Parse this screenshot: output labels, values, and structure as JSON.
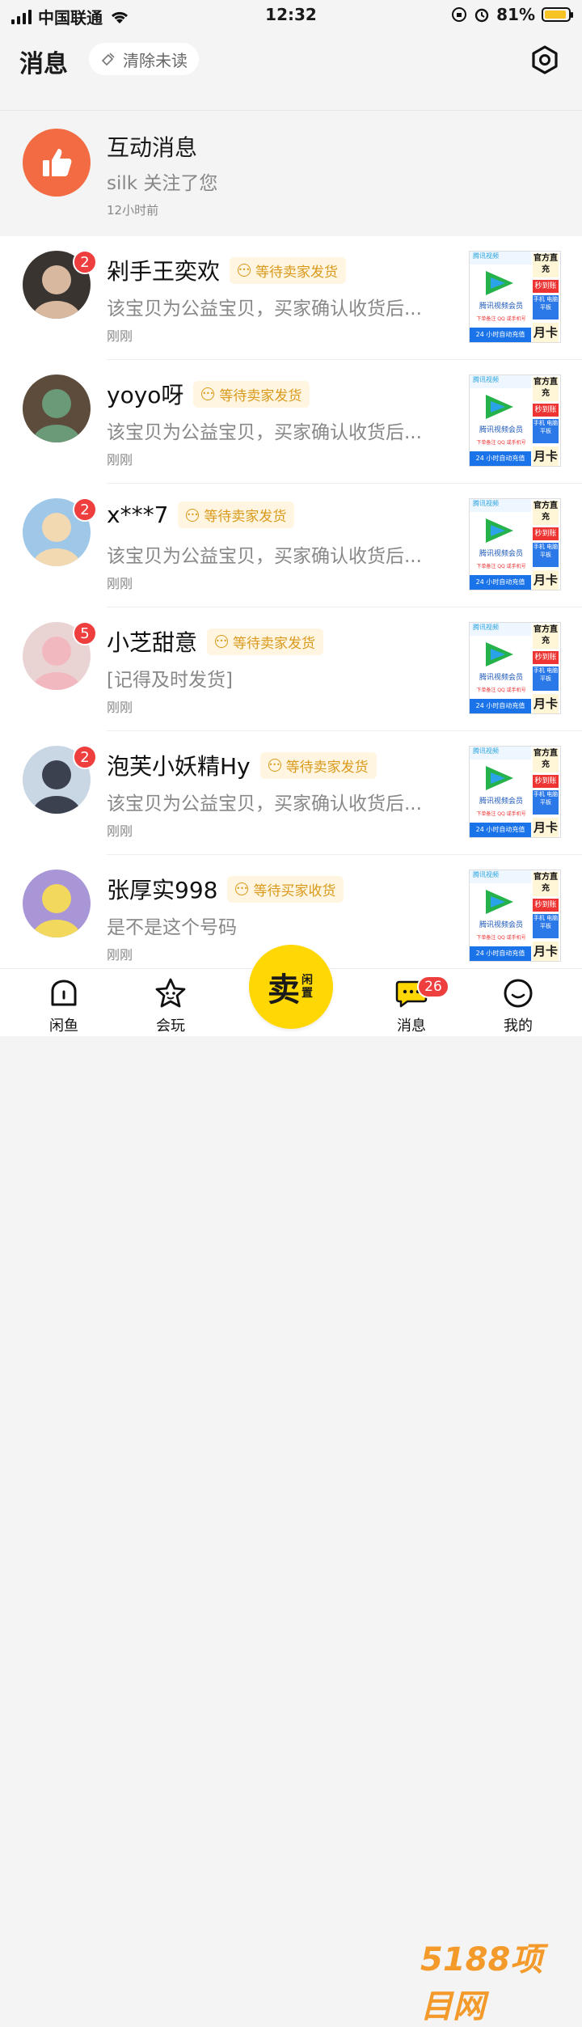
{
  "status_bar": {
    "carrier": "中国联通",
    "time": "12:32",
    "battery": "81%",
    "battery_level": 0.81
  },
  "header": {
    "title": "消息",
    "clear_unread": "清除未读"
  },
  "interaction": {
    "title": "互动消息",
    "subtitle": "silk 关注了您",
    "time": "12小时前"
  },
  "conversations": [
    {
      "name": "剁手王奕欢",
      "status": "等待卖家发货",
      "badge": "2",
      "preview": "该宝贝为公益宝贝，买家确认收货后...",
      "time": "刚刚"
    },
    {
      "name": "yoyo呀",
      "status": "等待卖家发货",
      "badge": "",
      "preview": "该宝贝为公益宝贝，买家确认收货后...",
      "time": "刚刚"
    },
    {
      "name": "x***7",
      "status": "等待卖家发货",
      "badge": "2",
      "preview": "该宝贝为公益宝贝，买家确认收货后...",
      "time": "刚刚"
    },
    {
      "name": "小芝甜意",
      "status": "等待卖家发货",
      "badge": "5",
      "preview": "[记得及时发货]",
      "time": "刚刚"
    },
    {
      "name": "泡芙小妖精Hy",
      "status": "等待卖家发货",
      "badge": "2",
      "preview": "该宝贝为公益宝贝，买家确认收货后...",
      "time": "刚刚"
    },
    {
      "name": "张厚实998",
      "status": "等待买家收货",
      "badge": "",
      "preview": "是不是这个号码",
      "time": "刚刚"
    }
  ],
  "product_card": {
    "brand": "腾讯视频",
    "name": "腾讯视频会员",
    "note": "下单备注 QQ 或手机号",
    "bottom": "24 小时自动充值",
    "badge_top": "官方直充",
    "badge_flash": "秒到账",
    "devices": "手机 电脑 平板",
    "period": "月卡"
  },
  "tabbar": {
    "home": "闲鱼",
    "play": "会玩",
    "sell_main": "卖",
    "sell_sub": "闲置",
    "messages": "消息",
    "messages_badge": "26",
    "mine": "我的"
  },
  "watermark": "5188项目网",
  "colors": {
    "accent": "#ffd803",
    "badge": "#ee3e3e",
    "tag_bg": "#fff5e0",
    "tag_text": "#d99a1c",
    "like_icon_bg": "#f26b43"
  }
}
